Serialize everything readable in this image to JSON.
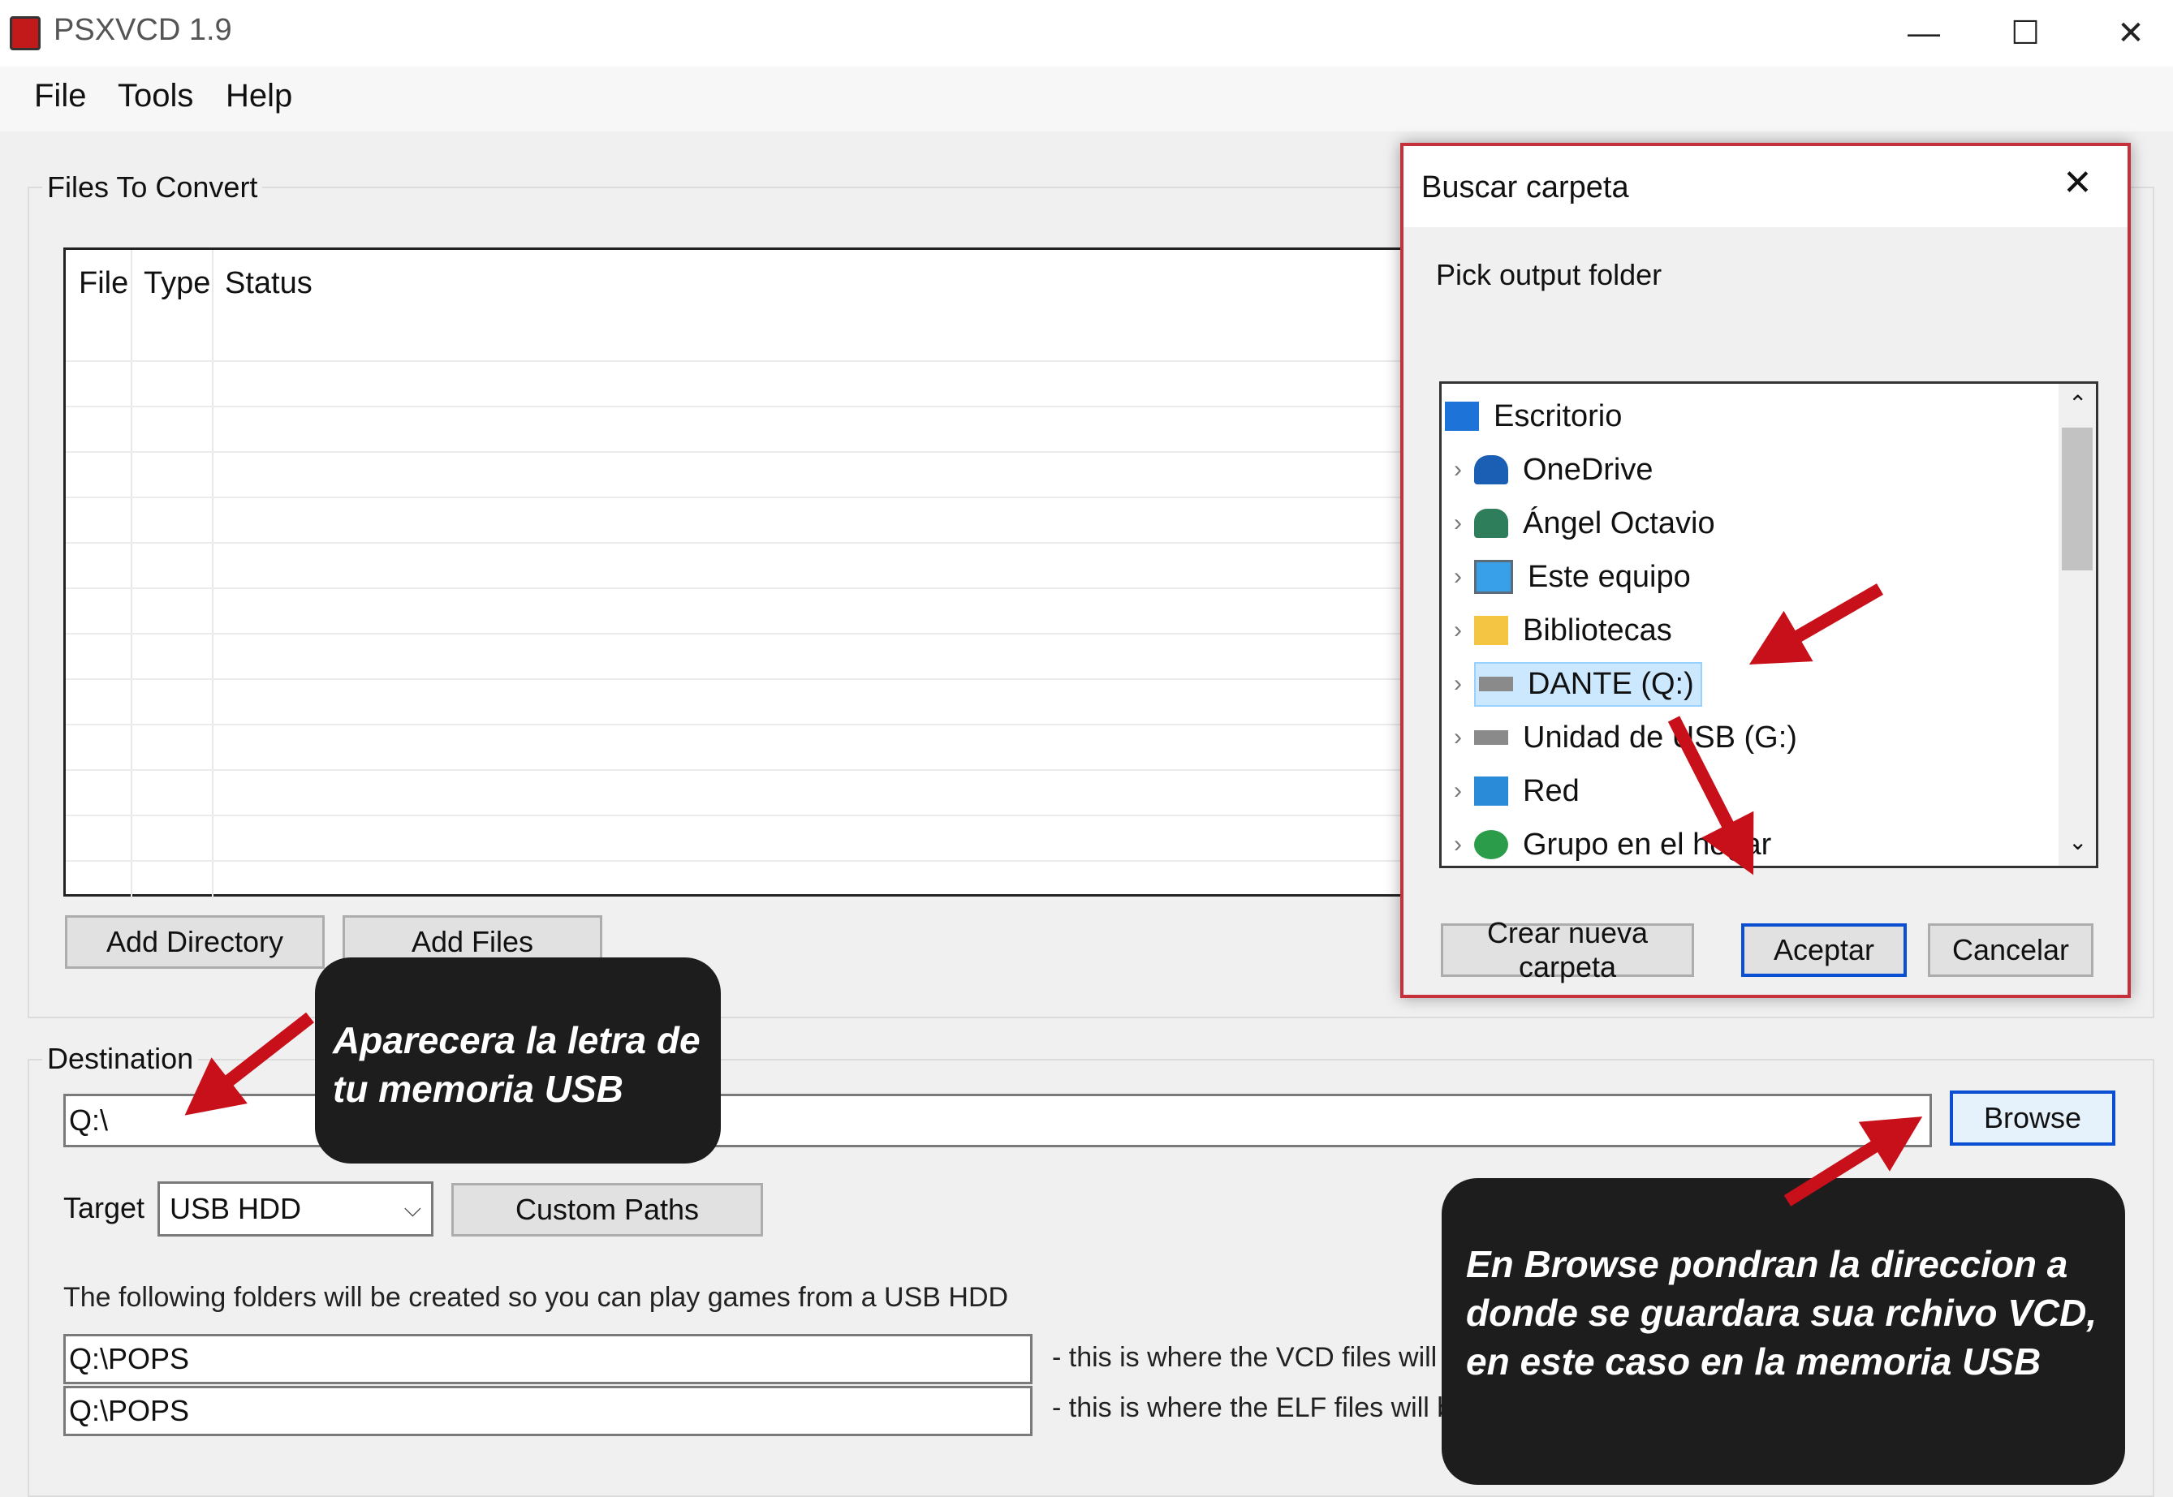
{
  "window": {
    "title": "PSXVCD 1.9",
    "controls": {
      "minimize": "—",
      "maximize": "☐",
      "close": "✕"
    }
  },
  "menu": [
    "File",
    "Tools",
    "Help"
  ],
  "files_group": {
    "label": "Files To Convert",
    "columns": [
      "File",
      "Type",
      "Status"
    ],
    "add_directory": "Add Directory",
    "add_files": "Add Files"
  },
  "destination": {
    "label": "Destination",
    "value": "Q:\\",
    "browse": "Browse",
    "target_label": "Target",
    "target_value": "USB HDD",
    "custom_paths": "Custom Paths",
    "info": "The following folders will be created so you can play games from a USB HDD",
    "paths": [
      {
        "value": "Q:\\POPS",
        "note": "- this is where the VCD files will be saved"
      },
      {
        "value": "Q:\\POPS",
        "note": "- this is where the ELF files will be saved in the format XX.FILENAME.ELF"
      }
    ]
  },
  "dialog": {
    "title": "Buscar carpeta",
    "prompt": "Pick output folder",
    "close": "✕",
    "tree": [
      {
        "label": "Escritorio",
        "icon": "desktop-icon",
        "expandable": false
      },
      {
        "label": "OneDrive",
        "icon": "onedrive-icon",
        "expandable": true
      },
      {
        "label": "Ángel Octavio",
        "icon": "user-icon",
        "expandable": true
      },
      {
        "label": "Este equipo",
        "icon": "computer-icon",
        "expandable": true
      },
      {
        "label": "Bibliotecas",
        "icon": "libraries-icon",
        "expandable": true
      },
      {
        "label": "DANTE (Q:)",
        "icon": "drive-icon",
        "expandable": true,
        "selected": true
      },
      {
        "label": "Unidad de USB (G:)",
        "icon": "drive-icon",
        "expandable": true
      },
      {
        "label": "Red",
        "icon": "network-icon",
        "expandable": true
      },
      {
        "label": "Grupo en el hogar",
        "icon": "homegroup-icon",
        "expandable": true
      }
    ],
    "new_folder": "Crear nueva carpeta",
    "ok": "Aceptar",
    "cancel": "Cancelar"
  },
  "callouts": {
    "usb_letter": "Aparecera la letra de tu memoria USB",
    "browse_hint": "En Browse pondran la direccion a donde se guardara sua rchivo VCD, en este caso en la memoria USB"
  },
  "colors": {
    "arrow": "#c8101a",
    "dialog_border": "#c6303a",
    "selection": "#cce8ff",
    "focus": "#0a4fd1"
  }
}
